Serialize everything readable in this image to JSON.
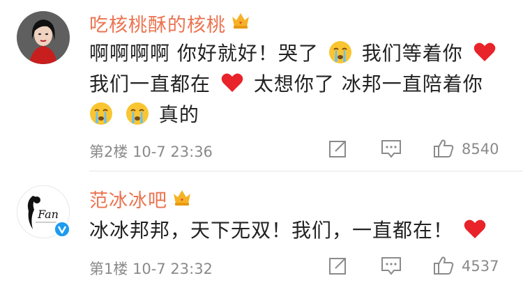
{
  "comments": [
    {
      "username": "吃核桃酥的核桃",
      "lines": [
        [
          "啊啊啊啊 你好就好！哭了",
          " 我们等着你"
        ],
        [
          "我们一直都在",
          " 太想你了 冰邦一直陪着你"
        ],
        [
          "",
          "",
          "真的"
        ]
      ],
      "floor": "第2楼",
      "time": "10-7 23:36",
      "likes": "8540",
      "avatar_icon": "woman-portrait-avatar",
      "badge_icon": "crown-member-icon"
    },
    {
      "username": "范冰冰吧",
      "text": "冰冰邦邦，天下无双！我们，一直都在！",
      "floor": "第1楼",
      "time": "10-7 23:32",
      "likes": "4537",
      "avatar_icon": "fan-logo-avatar",
      "avatar_text": "Fan",
      "verified_icon": "verified-v-badge",
      "badge_icon": "crown-member-icon"
    }
  ],
  "colors": {
    "username": "#eb7350",
    "text": "#222222",
    "meta": "#8a8a8a",
    "divider": "#e4e4e4",
    "heart": "#e8232a",
    "verified": "#1d9bf0"
  }
}
